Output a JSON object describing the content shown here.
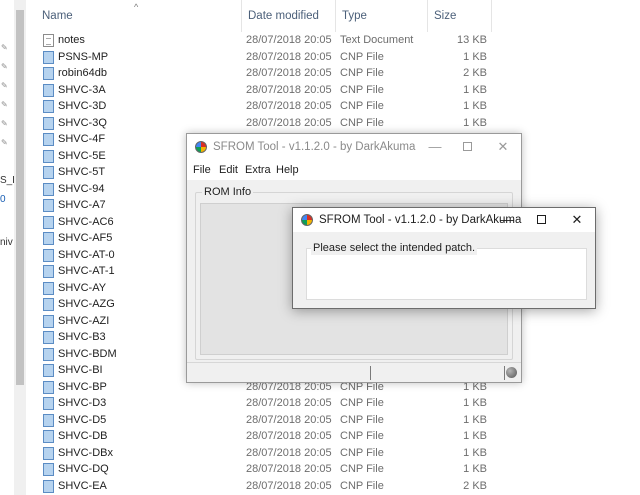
{
  "explorer": {
    "columns": {
      "name": "Name",
      "date": "Date modified",
      "type": "Type",
      "size": "Size"
    },
    "sort_indicator": "^",
    "left_strip_fragments": [
      "S_L",
      "0",
      "niv"
    ],
    "files": [
      {
        "name": "notes",
        "date": "28/07/2018 20:05",
        "type": "Text Document",
        "size": "13 KB",
        "icon": "text-document"
      },
      {
        "name": "PSNS-MP",
        "date": "28/07/2018 20:05",
        "type": "CNP File",
        "size": "1 KB",
        "icon": "cnp-file"
      },
      {
        "name": "robin64db",
        "date": "28/07/2018 20:05",
        "type": "CNP File",
        "size": "2 KB",
        "icon": "cnp-file"
      },
      {
        "name": "SHVC-3A",
        "date": "28/07/2018 20:05",
        "type": "CNP File",
        "size": "1 KB",
        "icon": "cnp-file"
      },
      {
        "name": "SHVC-3D",
        "date": "28/07/2018 20:05",
        "type": "CNP File",
        "size": "1 KB",
        "icon": "cnp-file"
      },
      {
        "name": "SHVC-3Q",
        "date": "28/07/2018 20:05",
        "type": "CNP File",
        "size": "1 KB",
        "icon": "cnp-file"
      },
      {
        "name": "SHVC-4F",
        "date": "",
        "type": "",
        "size": "",
        "icon": "cnp-file"
      },
      {
        "name": "SHVC-5E",
        "date": "",
        "type": "",
        "size": "",
        "icon": "cnp-file"
      },
      {
        "name": "SHVC-5T",
        "date": "",
        "type": "",
        "size": "",
        "icon": "cnp-file"
      },
      {
        "name": "SHVC-94",
        "date": "",
        "type": "",
        "size": "",
        "icon": "cnp-file"
      },
      {
        "name": "SHVC-A7",
        "date": "",
        "type": "",
        "size": "",
        "icon": "cnp-file"
      },
      {
        "name": "SHVC-AC6",
        "date": "",
        "type": "",
        "size": "",
        "icon": "cnp-file"
      },
      {
        "name": "SHVC-AF5",
        "date": "",
        "type": "",
        "size": "",
        "icon": "cnp-file"
      },
      {
        "name": "SHVC-AT-0",
        "date": "",
        "type": "",
        "size": "",
        "icon": "cnp-file"
      },
      {
        "name": "SHVC-AT-1",
        "date": "",
        "type": "",
        "size": "",
        "icon": "cnp-file"
      },
      {
        "name": "SHVC-AY",
        "date": "",
        "type": "",
        "size": "",
        "icon": "cnp-file"
      },
      {
        "name": "SHVC-AZG",
        "date": "",
        "type": "",
        "size": "",
        "icon": "cnp-file"
      },
      {
        "name": "SHVC-AZI",
        "date": "",
        "type": "",
        "size": "",
        "icon": "cnp-file"
      },
      {
        "name": "SHVC-B3",
        "date": "",
        "type": "",
        "size": "",
        "icon": "cnp-file"
      },
      {
        "name": "SHVC-BDM",
        "date": "",
        "type": "",
        "size": "",
        "icon": "cnp-file"
      },
      {
        "name": "SHVC-BI",
        "date": "",
        "type": "",
        "size": "",
        "icon": "cnp-file"
      },
      {
        "name": "SHVC-BP",
        "date": "28/07/2018 20:05",
        "type": "CNP File",
        "size": "1 KB",
        "icon": "cnp-file"
      },
      {
        "name": "SHVC-D3",
        "date": "28/07/2018 20:05",
        "type": "CNP File",
        "size": "1 KB",
        "icon": "cnp-file"
      },
      {
        "name": "SHVC-D5",
        "date": "28/07/2018 20:05",
        "type": "CNP File",
        "size": "1 KB",
        "icon": "cnp-file"
      },
      {
        "name": "SHVC-DB",
        "date": "28/07/2018 20:05",
        "type": "CNP File",
        "size": "1 KB",
        "icon": "cnp-file"
      },
      {
        "name": "SHVC-DBx",
        "date": "28/07/2018 20:05",
        "type": "CNP File",
        "size": "1 KB",
        "icon": "cnp-file"
      },
      {
        "name": "SHVC-DQ",
        "date": "28/07/2018 20:05",
        "type": "CNP File",
        "size": "1 KB",
        "icon": "cnp-file"
      },
      {
        "name": "SHVC-EA",
        "date": "28/07/2018 20:05",
        "type": "CNP File",
        "size": "2 KB",
        "icon": "cnp-file"
      }
    ]
  },
  "main_window": {
    "title": "SFROM Tool - v1.1.2.0 - by DarkAkuma",
    "controls": {
      "minimize": "—",
      "close": "✕"
    },
    "menu": [
      "File",
      "Edit",
      "Extra",
      "Help"
    ],
    "group_label": "ROM Info"
  },
  "patch_dialog": {
    "title": "SFROM Tool - v1.1.2.0 - by DarkAkuma",
    "controls": {
      "minimize": "—",
      "close": "✕"
    },
    "message": "Please select the intended patch."
  },
  "colors": {
    "header_text": "#4c607a",
    "cnp_icon": "#b6d3ef",
    "dialog_bg": "#f0f0f0"
  }
}
